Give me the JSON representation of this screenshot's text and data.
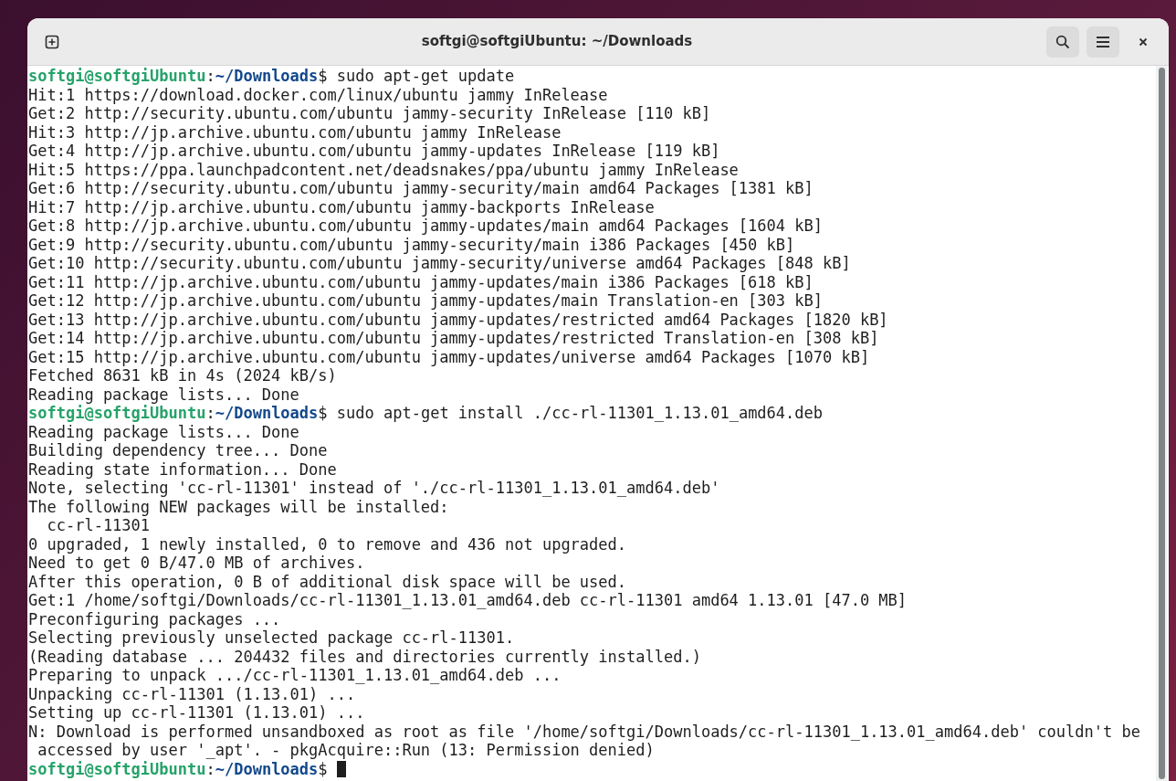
{
  "window": {
    "title": "softgi@softgiUbuntu: ~/Downloads"
  },
  "lines": [
    {
      "kind": "prompt",
      "user": "softgi@softgiUbuntu",
      "sep": ":",
      "path": "~/Downloads",
      "end": "$",
      "command": "sudo apt-get update",
      "cursor": false
    },
    {
      "kind": "output",
      "text": "Hit:1 https://download.docker.com/linux/ubuntu jammy InRelease"
    },
    {
      "kind": "output",
      "text": "Get:2 http://security.ubuntu.com/ubuntu jammy-security InRelease [110 kB]"
    },
    {
      "kind": "output",
      "text": "Hit:3 http://jp.archive.ubuntu.com/ubuntu jammy InRelease"
    },
    {
      "kind": "output",
      "text": "Get:4 http://jp.archive.ubuntu.com/ubuntu jammy-updates InRelease [119 kB]"
    },
    {
      "kind": "output",
      "text": "Hit:5 https://ppa.launchpadcontent.net/deadsnakes/ppa/ubuntu jammy InRelease"
    },
    {
      "kind": "output",
      "text": "Get:6 http://security.ubuntu.com/ubuntu jammy-security/main amd64 Packages [1381 kB]"
    },
    {
      "kind": "output",
      "text": "Hit:7 http://jp.archive.ubuntu.com/ubuntu jammy-backports InRelease"
    },
    {
      "kind": "output",
      "text": "Get:8 http://jp.archive.ubuntu.com/ubuntu jammy-updates/main amd64 Packages [1604 kB]"
    },
    {
      "kind": "output",
      "text": "Get:9 http://security.ubuntu.com/ubuntu jammy-security/main i386 Packages [450 kB]"
    },
    {
      "kind": "output",
      "text": "Get:10 http://security.ubuntu.com/ubuntu jammy-security/universe amd64 Packages [848 kB]"
    },
    {
      "kind": "output",
      "text": "Get:11 http://jp.archive.ubuntu.com/ubuntu jammy-updates/main i386 Packages [618 kB]"
    },
    {
      "kind": "output",
      "text": "Get:12 http://jp.archive.ubuntu.com/ubuntu jammy-updates/main Translation-en [303 kB]"
    },
    {
      "kind": "output",
      "text": "Get:13 http://jp.archive.ubuntu.com/ubuntu jammy-updates/restricted amd64 Packages [1820 kB]"
    },
    {
      "kind": "output",
      "text": "Get:14 http://jp.archive.ubuntu.com/ubuntu jammy-updates/restricted Translation-en [308 kB]"
    },
    {
      "kind": "output",
      "text": "Get:15 http://jp.archive.ubuntu.com/ubuntu jammy-updates/universe amd64 Packages [1070 kB]"
    },
    {
      "kind": "output",
      "text": "Fetched 8631 kB in 4s (2024 kB/s)"
    },
    {
      "kind": "output",
      "text": "Reading package lists... Done"
    },
    {
      "kind": "prompt",
      "user": "softgi@softgiUbuntu",
      "sep": ":",
      "path": "~/Downloads",
      "end": "$",
      "command": "sudo apt-get install ./cc-rl-11301_1.13.01_amd64.deb",
      "cursor": false
    },
    {
      "kind": "output",
      "text": "Reading package lists... Done"
    },
    {
      "kind": "output",
      "text": "Building dependency tree... Done"
    },
    {
      "kind": "output",
      "text": "Reading state information... Done"
    },
    {
      "kind": "output",
      "text": "Note, selecting 'cc-rl-11301' instead of './cc-rl-11301_1.13.01_amd64.deb'"
    },
    {
      "kind": "output",
      "text": "The following NEW packages will be installed:"
    },
    {
      "kind": "output",
      "text": "  cc-rl-11301"
    },
    {
      "kind": "output",
      "text": "0 upgraded, 1 newly installed, 0 to remove and 436 not upgraded."
    },
    {
      "kind": "output",
      "text": "Need to get 0 B/47.0 MB of archives."
    },
    {
      "kind": "output",
      "text": "After this operation, 0 B of additional disk space will be used."
    },
    {
      "kind": "output",
      "text": "Get:1 /home/softgi/Downloads/cc-rl-11301_1.13.01_amd64.deb cc-rl-11301 amd64 1.13.01 [47.0 MB]"
    },
    {
      "kind": "output",
      "text": "Preconfiguring packages ..."
    },
    {
      "kind": "output",
      "text": "Selecting previously unselected package cc-rl-11301."
    },
    {
      "kind": "output",
      "text": "(Reading database ... 204432 files and directories currently installed.)"
    },
    {
      "kind": "output",
      "text": "Preparing to unpack .../cc-rl-11301_1.13.01_amd64.deb ..."
    },
    {
      "kind": "output",
      "text": "Unpacking cc-rl-11301 (1.13.01) ..."
    },
    {
      "kind": "output",
      "text": "Setting up cc-rl-11301 (1.13.01) ..."
    },
    {
      "kind": "output",
      "text": "N: Download is performed unsandboxed as root as file '/home/softgi/Downloads/cc-rl-11301_1.13.01_amd64.deb' couldn't be"
    },
    {
      "kind": "output",
      "text": " accessed by user '_apt'. - pkgAcquire::Run (13: Permission denied)"
    },
    {
      "kind": "prompt",
      "user": "softgi@softgiUbuntu",
      "sep": ":",
      "path": "~/Downloads",
      "end": "$",
      "cursor": true
    }
  ]
}
